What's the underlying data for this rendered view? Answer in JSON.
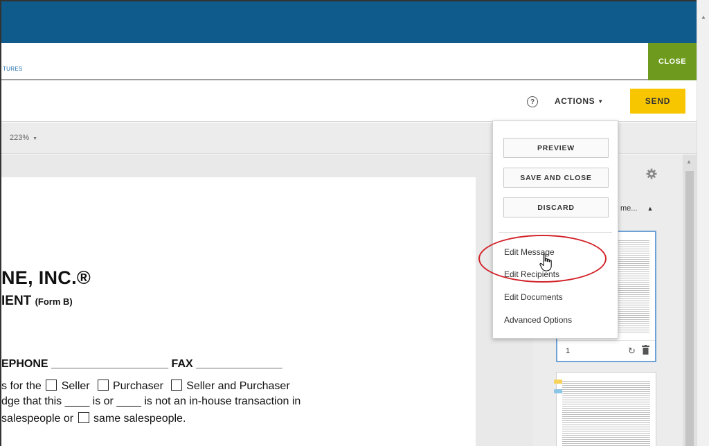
{
  "header": {
    "tab_fragment": "TURES",
    "close_label": "CLOSE"
  },
  "toolbar": {
    "help_icon": "?",
    "actions_label": "ACTIONS",
    "send_label": "SEND"
  },
  "viewer": {
    "zoom": "223%"
  },
  "document": {
    "line1": "NE, INC.®",
    "line2_main": "IENT",
    "line2_small": "(Form B)",
    "line3_part1": "EPHONE ___________________",
    "line3_part2": "FAX ______________",
    "line4_a": "s for the",
    "line4_b": "Seller",
    "line4_c": "Purchaser",
    "line4_d": "Seller and Purchaser",
    "line5": "dge that this ____ is or ____ is not an in-house transaction in",
    "line6_a": "salespeople or",
    "line6_b": "same salespeople."
  },
  "panel": {
    "title": "me...",
    "page_number": "1"
  },
  "actions_menu": {
    "buttons": [
      "PREVIEW",
      "SAVE AND CLOSE",
      "DISCARD"
    ],
    "items": [
      "Edit Message",
      "Edit Recipients",
      "Edit Documents",
      "Advanced Options"
    ]
  },
  "colors": {
    "topbar": "#0f5b8c",
    "close": "#6e9b1d",
    "send": "#f7c600",
    "highlight": "#d2232a"
  }
}
